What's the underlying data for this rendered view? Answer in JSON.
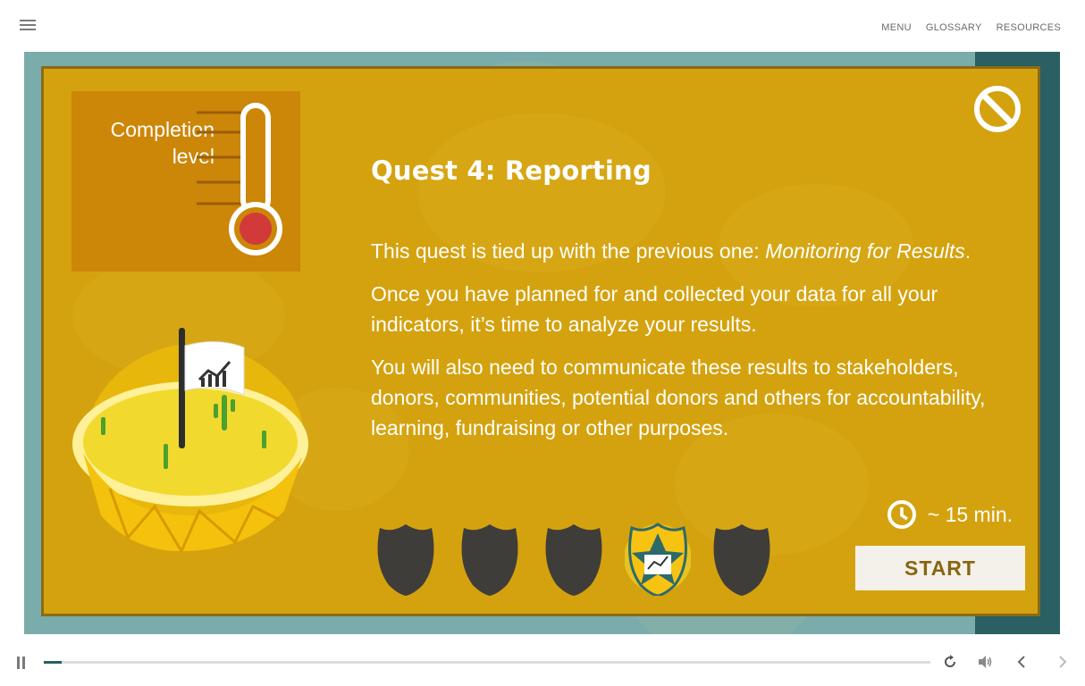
{
  "topnav": {
    "menu_label": "MENU",
    "glossary_label": "GLOSSARY",
    "resources_label": "RESOURCES"
  },
  "modal": {
    "completion_label_line1": "Completion",
    "completion_label_line2": "level",
    "title": "Quest 4: Reporting",
    "paragraph1_prefix": "This quest is tied up with the previous one: ",
    "paragraph1_italic": "Monitoring for Results",
    "paragraph1_suffix": ".",
    "paragraph2": "Once you have planned for and collected your data for all your indicators, it’s time to analyze your results.",
    "paragraph3": "You will also need to communicate these results to stakeholders, donors, communities, potential donors and others for accountability, learning, fundraising or other purposes.",
    "duration": "~ 15 min.",
    "start_label": "START",
    "badges": [
      {
        "state": "locked",
        "icon": "shield-icon"
      },
      {
        "state": "locked",
        "icon": "shield-icon"
      },
      {
        "state": "locked",
        "icon": "shield-icon"
      },
      {
        "state": "current",
        "icon": "star-shield-chart-icon"
      },
      {
        "state": "locked",
        "icon": "shield-icon"
      }
    ]
  },
  "player": {
    "progress_fraction": 0.02
  },
  "colors": {
    "modal_bg": "#d4a20e",
    "stage_bg": "#7aacab",
    "strip": "#2a5f63",
    "completion_box": "#cc8608",
    "start_text": "#8a6410"
  }
}
